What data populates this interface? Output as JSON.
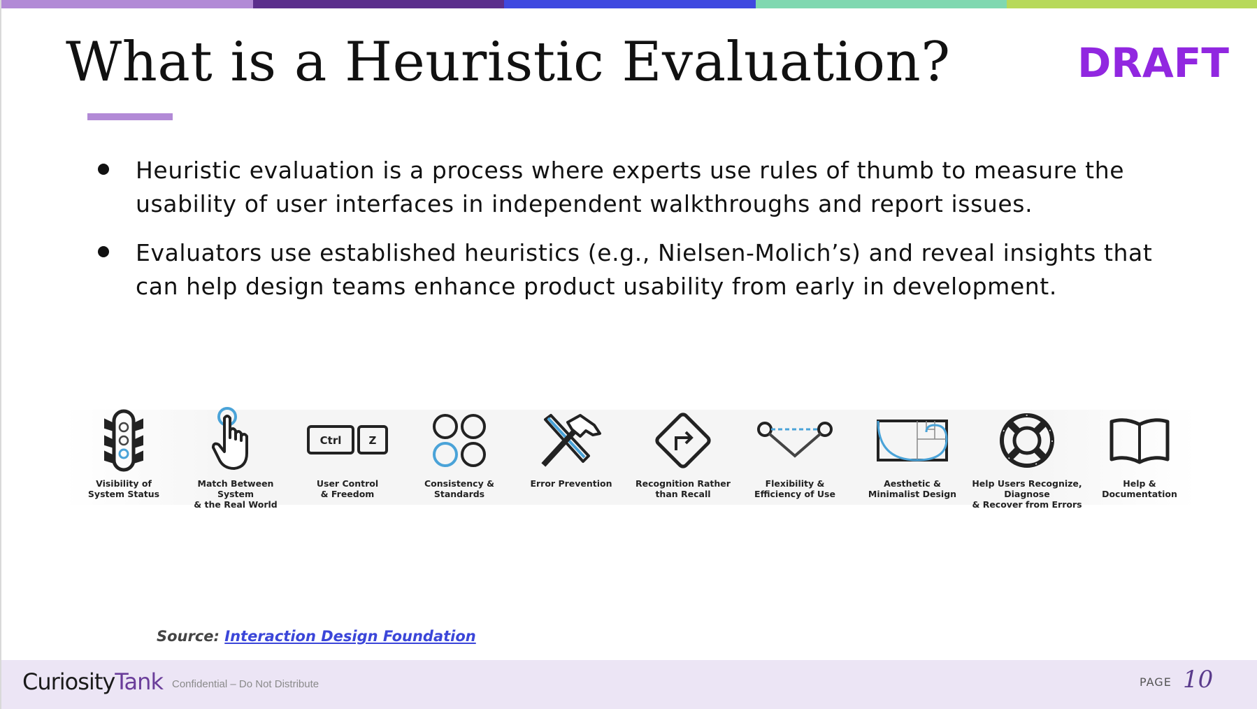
{
  "top_bar_colors": [
    "#b28ad6",
    "#5b2e8c",
    "#3f49e0",
    "#7fd8b0",
    "#b7d95a"
  ],
  "slide": {
    "title": "What is a Heuristic Evaluation?",
    "badge": "DRAFT",
    "bullets": [
      "Heuristic evaluation is a process where experts use rules of thumb to measure the usability of user interfaces in independent walkthroughs and report issues.",
      "Evaluators use established heuristics (e.g., Nielsen-Molich’s) and reveal insights that can help design teams enhance product usability from early in development."
    ],
    "heuristics": [
      {
        "label": "Visibility of\nSystem Status",
        "icon": "traffic-light-icon"
      },
      {
        "label": "Match Between System\n& the Real World",
        "icon": "pointing-hand-icon"
      },
      {
        "label": "User Control\n& Freedom",
        "icon": "ctrl-z-keys-icon",
        "keys": [
          "Ctrl",
          "Z"
        ]
      },
      {
        "label": "Consistency & Standards",
        "icon": "four-circles-icon"
      },
      {
        "label": "Error Prevention",
        "icon": "hammer-screwdriver-icon"
      },
      {
        "label": "Recognition Rather\nthan Recall",
        "icon": "turn-sign-icon"
      },
      {
        "label": "Flexibility &\nEfficiency of Use",
        "icon": "shortcut-path-icon"
      },
      {
        "label": "Aesthetic &\nMinimalist Design",
        "icon": "golden-ratio-icon"
      },
      {
        "label": "Help Users Recognize, Diagnose\n& Recover from Errors",
        "icon": "lifebuoy-icon"
      },
      {
        "label": "Help &\nDocumentation",
        "icon": "open-book-icon"
      }
    ],
    "source": {
      "prefix": "Source:",
      "link_text": "Interaction Design Foundation"
    }
  },
  "footer": {
    "logo_part1": "Curiosity",
    "logo_part2": "Tank",
    "confidential": "Confidential – Do Not Distribute",
    "page_label": "PAGE",
    "page_number": "10"
  },
  "colors": {
    "accent_purple": "#9127e0",
    "underline": "#b28ad6",
    "icon_blue": "#4aa3d8",
    "link_blue": "#3b46d9",
    "footer_bg": "#ece5f5"
  }
}
